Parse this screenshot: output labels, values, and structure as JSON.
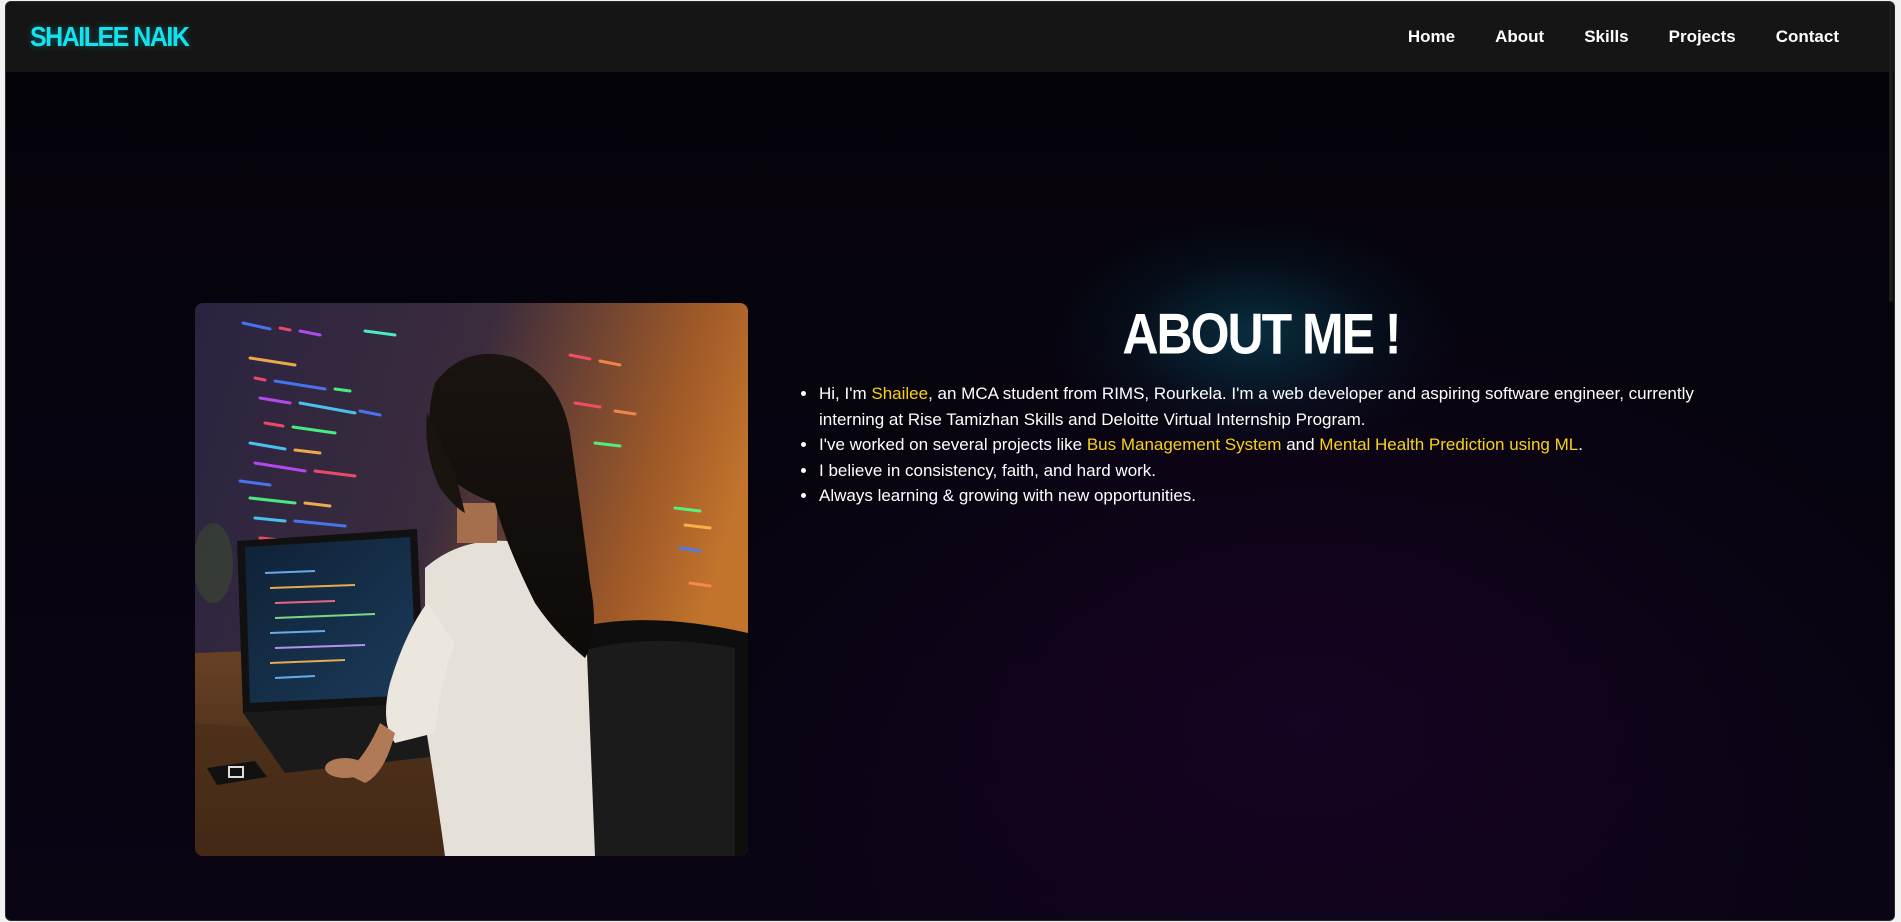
{
  "brand": {
    "name": "SHAILEE NAIK",
    "color": "#12e3ee"
  },
  "nav": {
    "items": [
      {
        "label": "Home"
      },
      {
        "label": "About"
      },
      {
        "label": "Skills"
      },
      {
        "label": "Projects"
      },
      {
        "label": "Contact"
      }
    ]
  },
  "about": {
    "title": "ABOUT ME !",
    "highlight_color": "#f7d219",
    "items": [
      {
        "parts": [
          "Hi, I'm ",
          "Shailee",
          ", an MCA student from RIMS, Rourkela. I'm a web developer and aspiring software engineer, currently interning at Rise Tamizhan Skills and Deloitte Virtual Internship Program."
        ]
      },
      {
        "parts": [
          "I've worked on several projects like ",
          "Bus Management System",
          " and ",
          "Mental Health Prediction using ML",
          "."
        ]
      },
      {
        "parts": [
          "I believe in consistency, faith, and hard work."
        ]
      },
      {
        "parts": [
          "Always learning & growing with new opportunities."
        ]
      }
    ]
  },
  "photo": {
    "subject": "woman-coding-at-laptop"
  }
}
